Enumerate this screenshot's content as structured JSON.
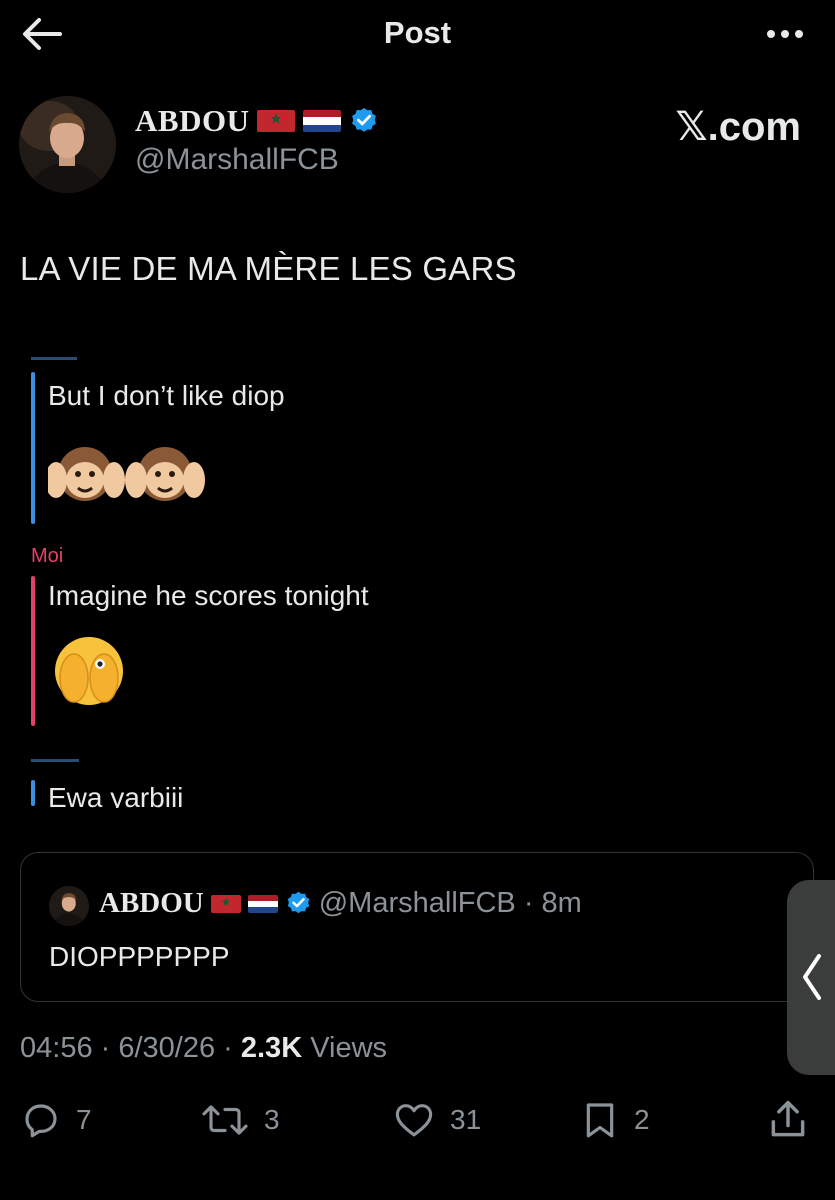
{
  "header": {
    "title": "Post",
    "back_icon": "arrow-left-icon",
    "more_icon": "more-horizontal-icon"
  },
  "author": {
    "display_name": "ABDOU",
    "handle": "@MarshallFCB",
    "flags": [
      "morocco-flag",
      "netherlands-flag"
    ],
    "verified": true
  },
  "watermark": "𝕏.com",
  "tweet": {
    "text": "LA VIE DE MA MÈRE LES GARS"
  },
  "chat": {
    "messages": [
      {
        "sender": "",
        "text": "But I don’t like diop",
        "emoji": "🙉🙉",
        "color": "#3b8fe0"
      },
      {
        "sender": "Moi",
        "text": "Imagine he scores tonight",
        "emoji": "🫣",
        "color": "#e0426a"
      },
      {
        "sender": "",
        "text": "Ewa yarbiii",
        "emoji": "",
        "color": "#3b8fe0"
      }
    ]
  },
  "quote": {
    "display_name": "ABDOU",
    "handle_time": "@MarshallFCB · 8m",
    "text": "DIOPPPPPPP"
  },
  "meta": {
    "time_date": "04:56 · 6/30/26 · ",
    "views_count": "2.3K",
    "views_label": " Views"
  },
  "actions": {
    "replies": "7",
    "reposts": "3",
    "likes": "31",
    "bookmarks": "2"
  },
  "colors": {
    "background": "#000000",
    "text": "#e7e9ea",
    "secondary": "#8b9298",
    "verified": "#1d9bf0",
    "border": "#2f3336"
  }
}
